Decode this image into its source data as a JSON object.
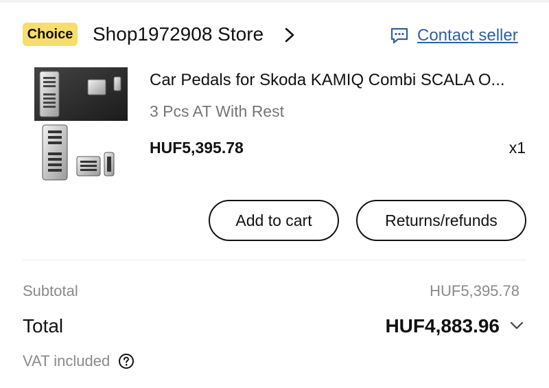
{
  "store": {
    "badge": "Choice",
    "name": "Shop1972908 Store",
    "contact_label": "Contact seller"
  },
  "item": {
    "title": "Car Pedals for Skoda KAMIQ Combi SCALA O...",
    "variant": "3 Pcs AT With Rest",
    "price": "HUF5,395.78",
    "quantity": "x1"
  },
  "actions": {
    "add_to_cart": "Add to cart",
    "returns": "Returns/refunds"
  },
  "summary": {
    "subtotal_label": "Subtotal",
    "subtotal_value": "HUF5,395.78",
    "total_label": "Total",
    "total_value": "HUF4,883.96",
    "vat_label": "VAT included"
  },
  "icons": {
    "store_chevron": "chevron-right-icon",
    "contact": "chat-bubble-icon",
    "total_expand": "chevron-down-icon",
    "vat_help": "question-circle-icon"
  },
  "colors": {
    "badge": "#f7dd6b",
    "link": "#2f5f9e",
    "muted": "#8a8a8a"
  }
}
